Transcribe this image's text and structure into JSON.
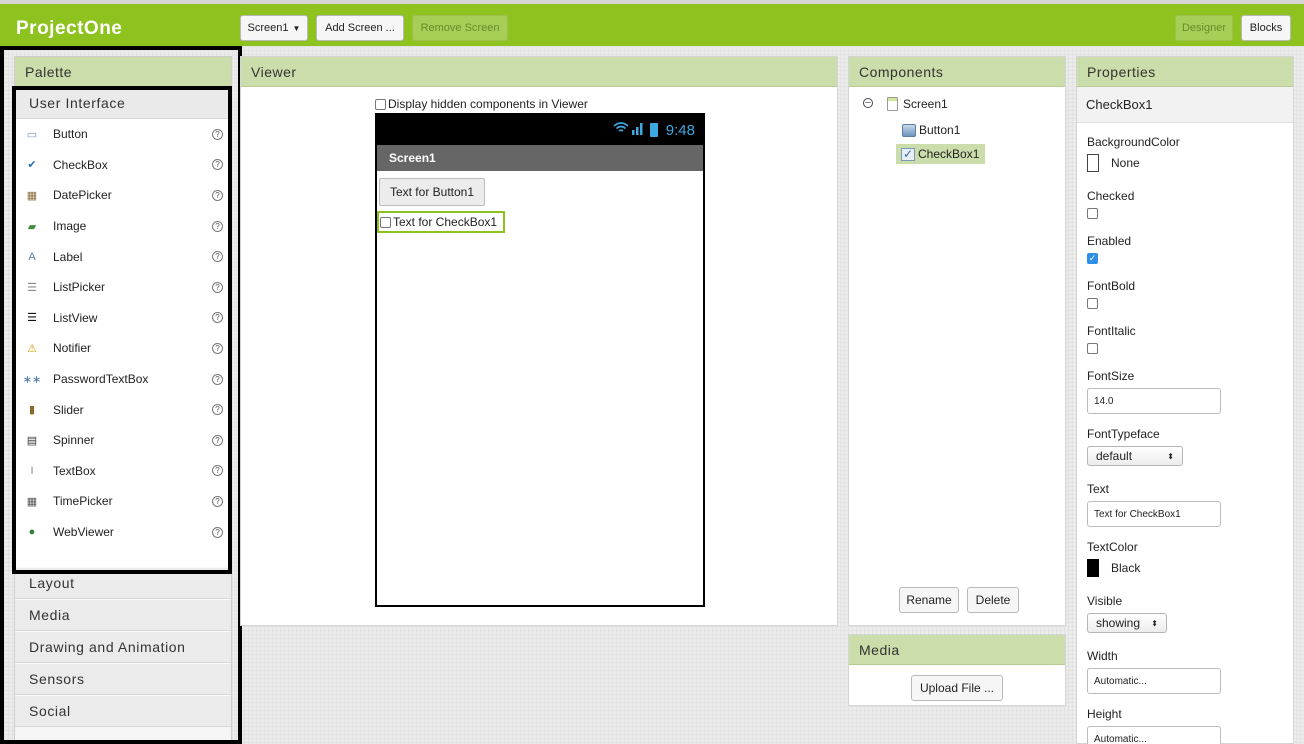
{
  "app": {
    "title": "ProjectOne"
  },
  "toolbar": {
    "screen_select": "Screen1",
    "add_screen": "Add Screen ...",
    "remove_screen": "Remove Screen",
    "designer": "Designer",
    "blocks": "Blocks"
  },
  "palette": {
    "title": "Palette",
    "open_category": "User Interface",
    "items": [
      {
        "label": "Button",
        "icon": "button-icon"
      },
      {
        "label": "CheckBox",
        "icon": "checkbox-icon"
      },
      {
        "label": "DatePicker",
        "icon": "datepicker-icon"
      },
      {
        "label": "Image",
        "icon": "image-icon"
      },
      {
        "label": "Label",
        "icon": "label-icon"
      },
      {
        "label": "ListPicker",
        "icon": "listpicker-icon"
      },
      {
        "label": "ListView",
        "icon": "listview-icon"
      },
      {
        "label": "Notifier",
        "icon": "notifier-icon"
      },
      {
        "label": "PasswordTextBox",
        "icon": "password-icon"
      },
      {
        "label": "Slider",
        "icon": "slider-icon"
      },
      {
        "label": "Spinner",
        "icon": "spinner-icon"
      },
      {
        "label": "TextBox",
        "icon": "textbox-icon"
      },
      {
        "label": "TimePicker",
        "icon": "timepicker-icon"
      },
      {
        "label": "WebViewer",
        "icon": "webviewer-icon"
      }
    ],
    "help_glyph": "?",
    "categories": [
      "Layout",
      "Media",
      "Drawing and Animation",
      "Sensors",
      "Social"
    ]
  },
  "viewer": {
    "title": "Viewer",
    "hidden_label": "Display hidden components in Viewer",
    "time": "9:48",
    "screen_title": "Screen1",
    "button_text": "Text for Button1",
    "checkbox_text": "Text for CheckBox1"
  },
  "components": {
    "title": "Components",
    "root": "Screen1",
    "children": [
      "Button1",
      "CheckBox1"
    ],
    "rename": "Rename",
    "delete": "Delete"
  },
  "media": {
    "title": "Media",
    "upload": "Upload File ..."
  },
  "properties": {
    "title": "Properties",
    "component": "CheckBox1",
    "background_color_label": "BackgroundColor",
    "background_color_value": "None",
    "checked_label": "Checked",
    "checked": false,
    "enabled_label": "Enabled",
    "enabled": true,
    "fontbold_label": "FontBold",
    "fontbold": false,
    "fontitalic_label": "FontItalic",
    "fontitalic": false,
    "fontsize_label": "FontSize",
    "fontsize_value": "14.0",
    "fonttypeface_label": "FontTypeface",
    "fonttypeface_value": "default",
    "text_label": "Text",
    "text_value": "Text for CheckBox1",
    "textcolor_label": "TextColor",
    "textcolor_value": "Black",
    "visible_label": "Visible",
    "visible_value": "showing",
    "width_label": "Width",
    "width_value": "Automatic...",
    "height_label": "Height",
    "height_value": "Automatic..."
  },
  "colors": {
    "accent": "#8dc21f",
    "header": "#cbddaa",
    "selected": "#2f8ee6"
  }
}
